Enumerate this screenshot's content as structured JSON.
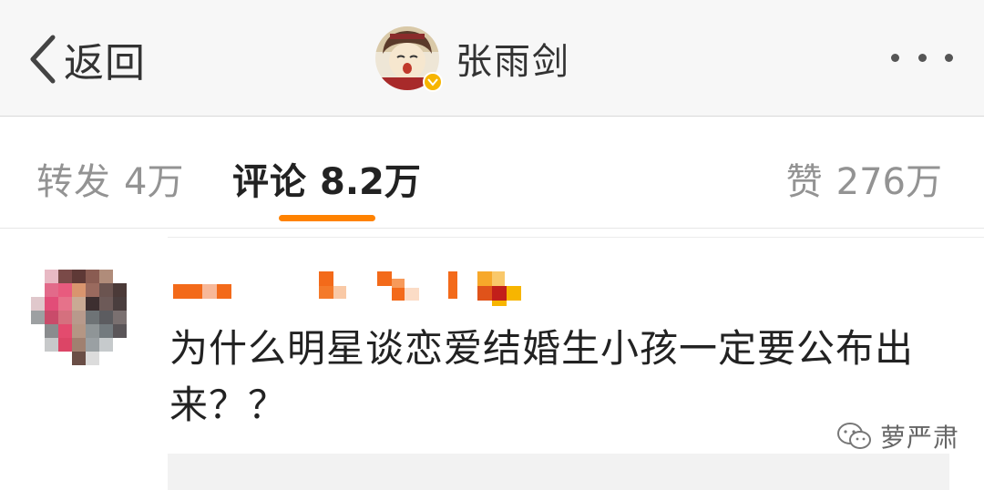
{
  "nav": {
    "back_label": "返回",
    "profile_name": "张雨剑",
    "verified_color": "#f7b500"
  },
  "tabs": {
    "repost_label": "转发",
    "repost_count": "4万",
    "comment_label": "评论",
    "comment_count": "8.2万",
    "like_label": "赞",
    "like_count": "276万",
    "active_tab": "comment",
    "accent_color": "#ff8200"
  },
  "comment": {
    "text": "为什么明星谈恋爱结婚生小孩一定要公布出来？？"
  },
  "watermark": {
    "text": "萝严肃"
  }
}
